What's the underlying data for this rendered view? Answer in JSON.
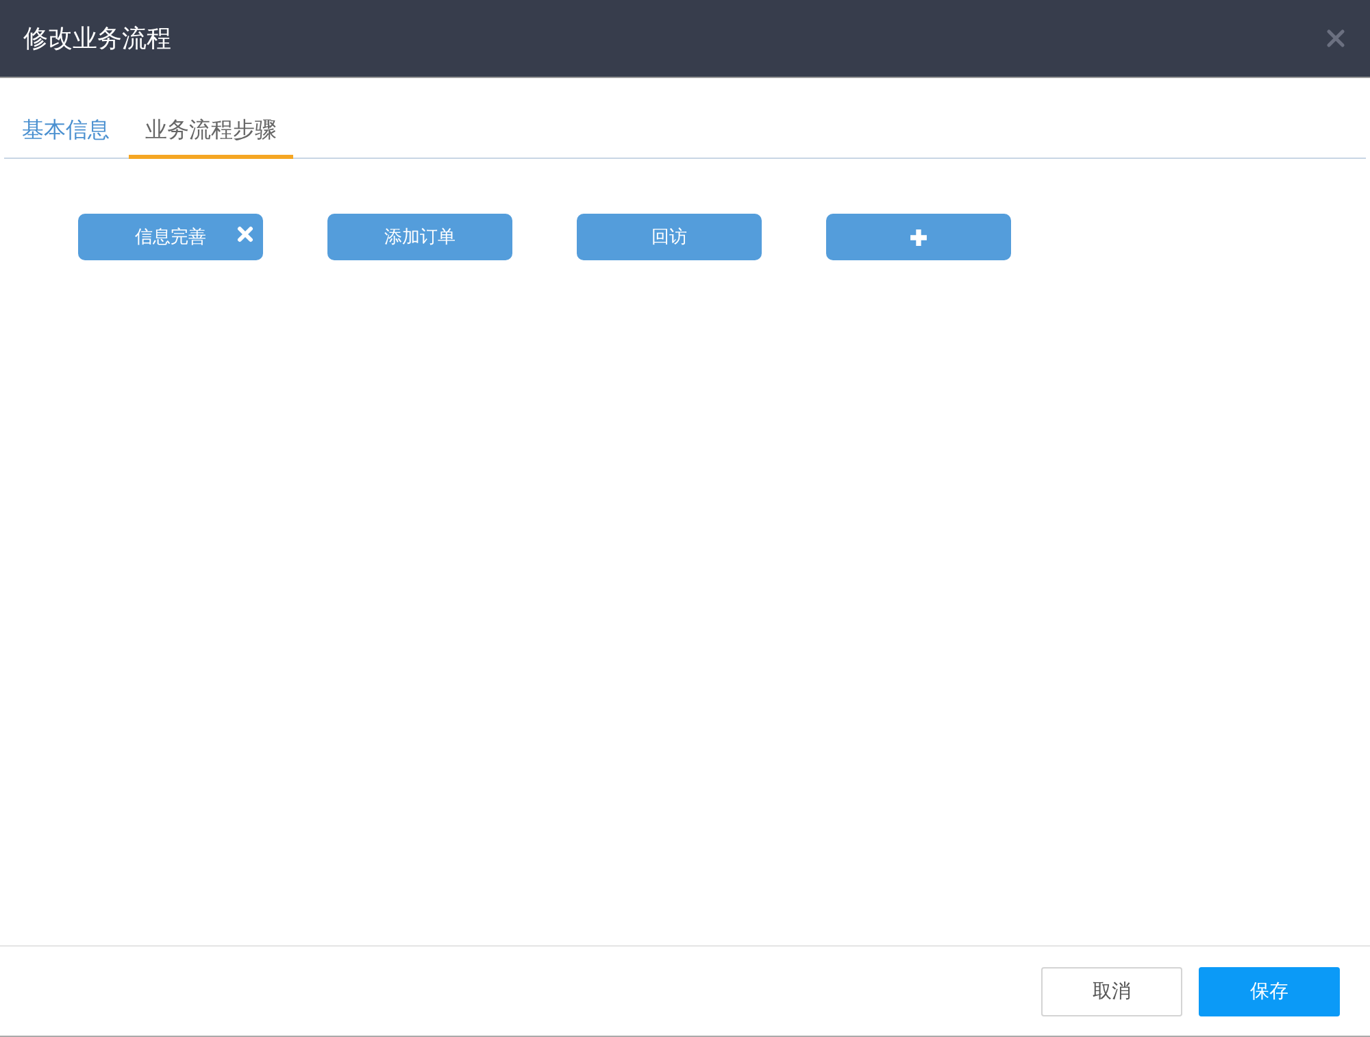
{
  "dialog": {
    "title": "修改业务流程"
  },
  "tabs": [
    {
      "label": "基本信息",
      "selected": false
    },
    {
      "label": "业务流程步骤",
      "selected": true
    }
  ],
  "steps": [
    {
      "label": "信息完善",
      "removable": true
    },
    {
      "label": "添加订单",
      "removable": false
    },
    {
      "label": "回访",
      "removable": false
    }
  ],
  "footer": {
    "buttons": [
      {
        "label": "取消",
        "kind": "secondary"
      },
      {
        "label": "保存",
        "kind": "primary"
      }
    ]
  }
}
